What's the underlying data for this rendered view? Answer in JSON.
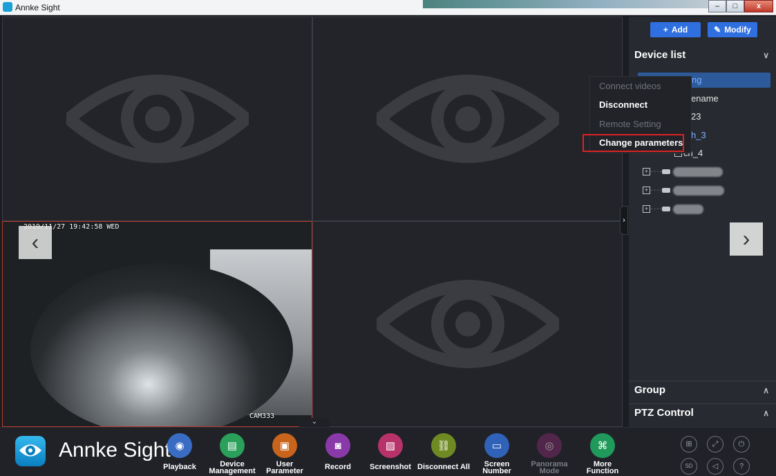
{
  "window": {
    "title": "Annke Sight",
    "minimize": "–",
    "maximize": "□",
    "close": "x"
  },
  "camera": {
    "timestamp": "2019/11/27 19:42:58 WED",
    "name": "CAM333"
  },
  "panel": {
    "add_label": "Add",
    "modify_label": "Modify",
    "device_list_title": "Device list",
    "group_title": "Group",
    "ptz_title": "PTZ Control",
    "tree": [
      {
        "label": "ng",
        "selected": true
      },
      {
        "label": "ename"
      },
      {
        "label": "23"
      },
      {
        "label": "h_3"
      },
      {
        "label": "ch_4"
      }
    ]
  },
  "context_menu": {
    "items": [
      {
        "label": "Connect videos",
        "enabled": false
      },
      {
        "label": "Disconnect",
        "enabled": true
      },
      {
        "label": "Remote Setting",
        "enabled": false
      },
      {
        "label": "Change parameters",
        "enabled": true
      }
    ]
  },
  "toolbar": {
    "brand": "Annke Sight",
    "tools": [
      {
        "line1": "Playback",
        "line2": "",
        "color": "#3a6cc4",
        "icon": "playback-icon"
      },
      {
        "line1": "Device",
        "line2": "Management",
        "color": "#2aa05a",
        "icon": "device-management-icon"
      },
      {
        "line1": "User",
        "line2": "Parameter",
        "color": "#c8641c",
        "icon": "user-parameter-icon"
      },
      {
        "line1": "Record",
        "line2": "",
        "color": "#8a3aa8",
        "icon": "record-icon"
      },
      {
        "line1": "Screenshot",
        "line2": "",
        "color": "#b8326a",
        "icon": "screenshot-icon"
      },
      {
        "line1": "Disconnect All",
        "line2": "",
        "color": "#6f8a22",
        "icon": "disconnect-all-icon"
      },
      {
        "line1": "Screen",
        "line2": "Number",
        "color": "#2f62b8",
        "icon": "screen-number-icon"
      },
      {
        "line1": "Panorama",
        "line2": "Mode",
        "color": "#7a2a66",
        "icon": "panorama-mode-icon",
        "disabled": true
      },
      {
        "line1": "More",
        "line2": "Function",
        "color": "#1f9a5a",
        "icon": "more-function-icon"
      }
    ],
    "small_icons": [
      "multi-camera-icon",
      "fullscreen-icon",
      "power-icon",
      "sd-icon",
      "mute-icon",
      "help-icon"
    ]
  }
}
